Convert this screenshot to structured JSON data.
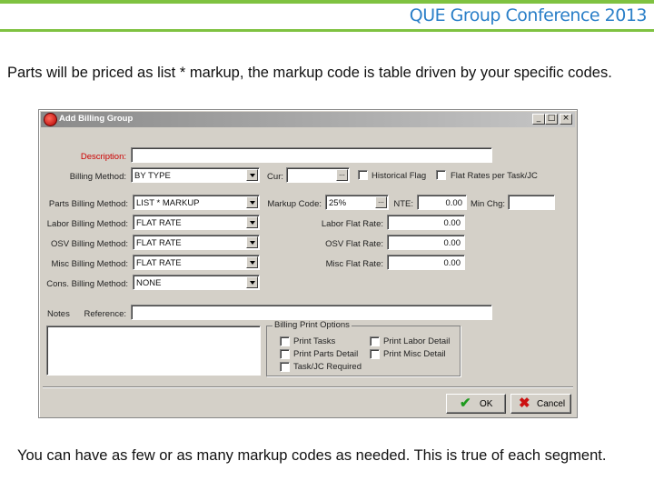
{
  "slide": {
    "conference_title": "QUE Group Conference 2013",
    "intro_text": "Parts will be priced as list * markup, the markup code is table driven by your specific codes.",
    "footer_text": "You can have as few or as many markup codes as needed.  This is true of each segment."
  },
  "window": {
    "title": "Add Billing Group",
    "min_glyph": "_",
    "max_glyph": "□",
    "close_glyph": "×"
  },
  "form": {
    "description_label": "Description:",
    "description_value": "",
    "billing_method_label": "Billing Method:",
    "billing_method_value": "BY TYPE",
    "cur_label": "Cur:",
    "cur_value": "",
    "ellipsis": "...",
    "historical_flag_label": "Historical Flag",
    "flat_rates_label": "Flat Rates per Task/JC",
    "parts_billing_label": "Parts Billing Method:",
    "parts_billing_value": "LIST * MARKUP",
    "markup_code_label": "Markup Code:",
    "markup_code_value": "25%",
    "nte_label": "NTE:",
    "nte_value": "0.00",
    "min_chg_label": "Min Chg:",
    "min_chg_value": "",
    "labor_billing_label": "Labor Billing Method:",
    "labor_billing_value": "FLAT RATE",
    "labor_flat_rate_label": "Labor Flat Rate:",
    "labor_flat_rate_value": "0.00",
    "osv_billing_label": "OSV Billing Method:",
    "osv_billing_value": "FLAT RATE",
    "osv_flat_rate_label": "OSV Flat Rate:",
    "osv_flat_rate_value": "0.00",
    "misc_billing_label": "Misc Billing Method:",
    "misc_billing_value": "FLAT RATE",
    "misc_flat_rate_label": "Misc Flat Rate:",
    "misc_flat_rate_value": "0.00",
    "cons_billing_label": "Cons. Billing Method:",
    "cons_billing_value": "NONE",
    "notes_label": "Notes",
    "reference_label": "Reference:",
    "reference_value": ""
  },
  "print_options": {
    "title": "Billing Print Options",
    "print_tasks": "Print Tasks",
    "print_labor_detail": "Print Labor Detail",
    "print_parts_detail": "Print Parts Detail",
    "print_misc_detail": "Print Misc Detail",
    "task_jc_required": "Task/JC Required"
  },
  "buttons": {
    "ok_label": "OK",
    "cancel_label": "Cancel",
    "ok_icon": "✔",
    "cancel_icon": "✖"
  },
  "colors": {
    "accent_green": "#7fc241",
    "title_blue": "#2a7fc8",
    "required_red": "#cc0000"
  }
}
